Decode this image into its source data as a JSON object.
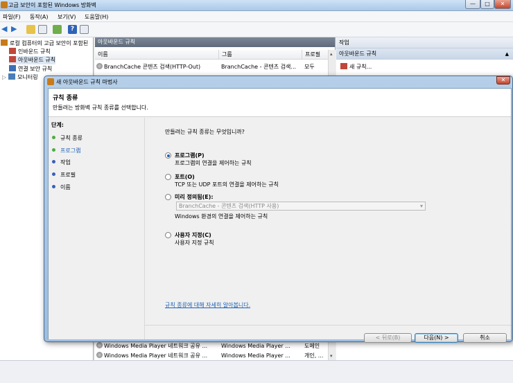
{
  "window": {
    "title": "고급 보안이 포함된 Windows 방화벽"
  },
  "menu": [
    "파일(F)",
    "동작(A)",
    "보기(V)",
    "도움말(H)"
  ],
  "tree": {
    "root": "로컬 컴퓨터의 고급 보안이 포함된",
    "items": [
      "인바운드 규칙",
      "아웃바운드 규칙",
      "연결 보안 규칙",
      "모니터링"
    ]
  },
  "center": {
    "header": "아웃바운드 규칙",
    "columns": [
      "이름",
      "그룹",
      "프로필"
    ],
    "top_rows": [
      {
        "name": "BranchCache 콘텐츠 검색(HTTP-Out)",
        "group": "BranchCache - 콘텐츠 검색...",
        "profile": "모두"
      }
    ],
    "bottom_rows": [
      {
        "name": "Windows Media Player 네트워크 공유 ...",
        "group": "Windows Media Player ...",
        "profile": "도메인"
      },
      {
        "name": "Windows Media Player 네트워크 공유 ...",
        "group": "Windows Media Player ...",
        "profile": "개인, ..."
      }
    ]
  },
  "actions": {
    "header": "작업",
    "section": "아웃바운드 규칙",
    "items": [
      "새 규칙..."
    ]
  },
  "dialog": {
    "title": "새 아웃바운드 규칙 마법사",
    "heading": "규칙 종류",
    "subheading": "만들려는 방화벽 규칙 종류를 선택합니다.",
    "steps_label": "단계:",
    "steps": [
      "규칙 종류",
      "프로그램",
      "작업",
      "프로필",
      "이름"
    ],
    "question": "만들려는 규칙 종류는 무엇입니까?",
    "options": [
      {
        "label": "프로그램(P)",
        "desc": "프로그램의 연결을 제어하는 규칙"
      },
      {
        "label": "포트(O)",
        "desc": "TCP 또는 UDP 포트의 연결을 제어하는 규칙"
      },
      {
        "label": "미리 정의됨(E):",
        "desc": "Windows 환경의 연결을 제어하는 규칙"
      },
      {
        "label": "사용자 지정(C)",
        "desc": "사용자 지정 규칙"
      }
    ],
    "predefined_value": "BranchCache - 콘텐츠 검색(HTTP 사용)",
    "help_link": "규칙 종류에 대해 자세히 알아봅니다.",
    "buttons": {
      "back": "< 뒤로(B)",
      "next": "다음(N) >",
      "cancel": "취소"
    }
  }
}
